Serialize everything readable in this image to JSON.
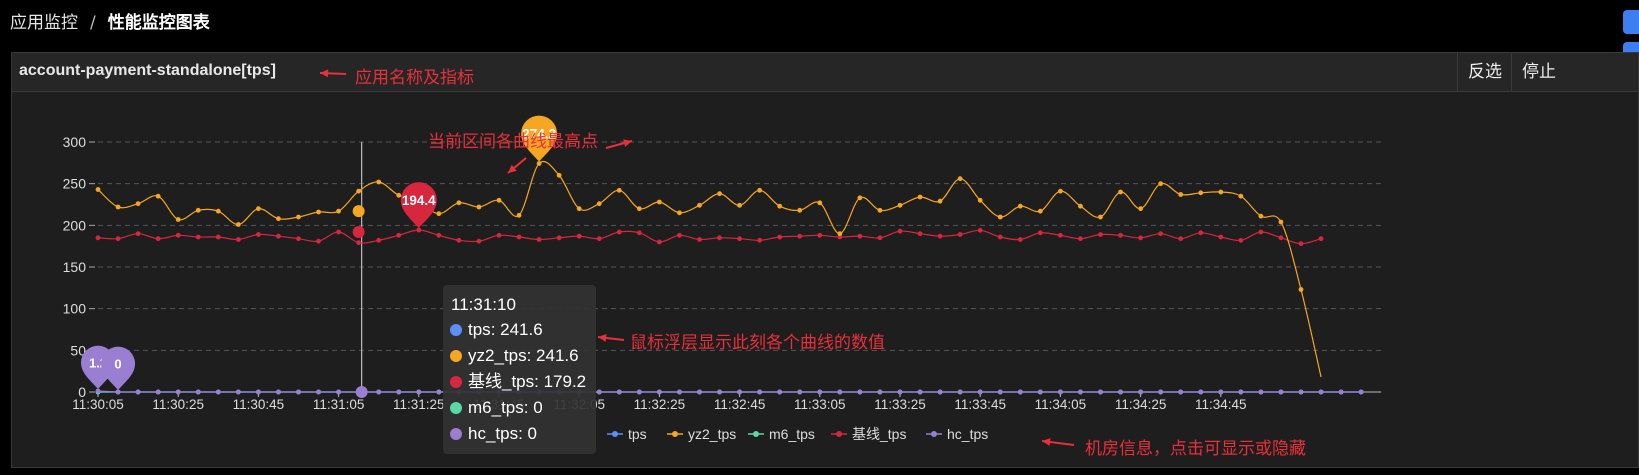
{
  "breadcrumb": {
    "root": "应用监控",
    "separator": "/",
    "current": "性能监控图表"
  },
  "panel": {
    "title": "account-payment-standalone[tps]",
    "invert_label": "反选",
    "stop_label": "停止"
  },
  "annotations": {
    "title_note": "应用名称及指标",
    "peak_note": "当前区间各曲线最高点",
    "tooltip_note": "鼠标浮层显示此刻各个曲线的数值",
    "legend_note": "机房信息，点击可显示或隐藏"
  },
  "tooltip": {
    "time": "11:31:10",
    "rows": [
      {
        "name": "tps",
        "value": "241.6",
        "color": "#5b8ff9"
      },
      {
        "name": "yz2_tps",
        "value": "241.6",
        "color": "#f5a623"
      },
      {
        "name": "基线_tps",
        "value": "179.2",
        "color": "#d7263d"
      },
      {
        "name": "m6_tps",
        "value": "0",
        "color": "#5ad8a6"
      },
      {
        "name": "hc_tps",
        "value": "0",
        "color": "#9a7ed1"
      }
    ]
  },
  "chart_data": {
    "type": "line",
    "ylim": [
      0,
      300
    ],
    "yticks": [
      0,
      50,
      100,
      150,
      200,
      250,
      300
    ],
    "grid": true,
    "legend_position": "bottom",
    "x_start": "11:30:05",
    "x_step_seconds": 5,
    "xticks": [
      "11:30:05",
      "11:30:25",
      "11:30:45",
      "11:31:05",
      "11:31:25",
      "11:31:45",
      "11:32:05",
      "11:32:25",
      "11:32:45",
      "11:33:05",
      "11:33:25",
      "11:33:45",
      "11:34:05",
      "11:34:25",
      "11:34:45"
    ],
    "series": [
      {
        "name": "tps",
        "color": "#5b8ff9",
        "values": [
          0,
          0,
          0,
          0,
          0,
          0,
          0,
          0,
          0,
          0,
          0,
          0,
          0,
          0,
          0,
          0,
          0,
          0,
          0,
          0,
          0,
          0,
          0,
          0,
          0,
          0,
          0,
          0,
          0,
          0,
          0,
          0,
          0,
          0,
          0,
          0,
          0,
          0,
          0,
          0,
          0,
          0,
          0,
          0,
          0,
          0,
          0,
          0,
          0,
          0,
          0,
          0,
          0,
          0,
          0,
          0,
          0,
          0,
          0,
          0,
          0,
          0,
          0,
          0
        ]
      },
      {
        "name": "yz2_tps",
        "color": "#f5a623",
        "values": [
          243,
          222,
          226,
          235,
          207,
          218,
          217,
          201,
          220,
          208,
          210,
          216,
          217,
          241,
          252,
          236,
          228,
          214,
          227,
          222,
          230,
          212,
          274.2,
          260,
          220,
          226,
          242,
          220,
          228,
          215,
          224,
          238,
          224,
          242,
          223,
          218,
          227,
          190,
          233,
          218,
          224,
          234,
          229,
          256,
          230,
          210,
          223,
          217,
          241,
          223,
          210,
          240,
          220,
          250,
          237,
          239,
          240,
          235,
          211,
          204,
          123,
          18
        ]
      },
      {
        "name": "m6_tps",
        "color": "#5ad8a6",
        "values": [
          0,
          0,
          0,
          0,
          0,
          0,
          0,
          0,
          0,
          0,
          0,
          0,
          0,
          0,
          0,
          0,
          0,
          0,
          0,
          0,
          0,
          0,
          0,
          0,
          0,
          0,
          0,
          0,
          0,
          0,
          0,
          0,
          0,
          0,
          0,
          0,
          0,
          0,
          0,
          0,
          0,
          0,
          0,
          0,
          0,
          0,
          0,
          0,
          0,
          0,
          0,
          0,
          0,
          0,
          0,
          0,
          0,
          0,
          0,
          0,
          0,
          0,
          0,
          0
        ]
      },
      {
        "name": "基线_tps",
        "color": "#d7263d",
        "values": [
          185,
          184,
          190,
          184,
          188,
          186,
          186,
          183,
          189,
          187,
          184,
          181,
          192,
          179.2,
          182,
          188,
          194.4,
          188,
          182,
          181,
          188,
          186,
          183,
          185,
          187,
          184,
          192,
          191,
          180,
          188,
          183,
          185,
          184,
          182,
          186,
          187,
          188,
          186,
          187,
          185,
          193,
          190,
          187,
          189,
          194,
          186,
          183,
          191,
          188,
          184,
          189,
          188,
          185,
          190,
          184,
          191,
          186,
          182,
          192,
          185,
          178,
          184
        ]
      },
      {
        "name": "hc_tps",
        "color": "#9a7ed1",
        "values": [
          1.2,
          0,
          0,
          0,
          0,
          0,
          0,
          0,
          0,
          0,
          0,
          0,
          0,
          0,
          0,
          0,
          0,
          0,
          0,
          0,
          0,
          0,
          0,
          0,
          0,
          0,
          0,
          0,
          0,
          0,
          0,
          0,
          0,
          0,
          0,
          0,
          0,
          0,
          0,
          0,
          0,
          0,
          0,
          0,
          0,
          0,
          0,
          0,
          0,
          0,
          0,
          0,
          0,
          0,
          0,
          0,
          0,
          0,
          0,
          0,
          0,
          0,
          0,
          0
        ]
      }
    ],
    "markers": [
      {
        "series": "yz2_tps",
        "index": 22,
        "label": "274.2"
      },
      {
        "series": "基线_tps",
        "index": 16,
        "label": "194.4"
      },
      {
        "series": "hc_tps",
        "index": 0,
        "label": "1.2"
      },
      {
        "series": "hc_tps",
        "index": 1,
        "label": "0"
      }
    ],
    "hover_index": 13
  }
}
